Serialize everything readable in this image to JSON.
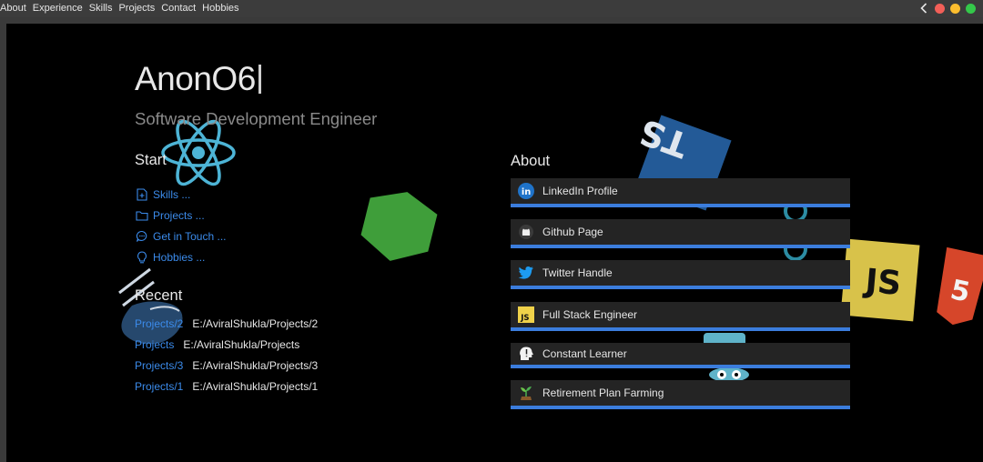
{
  "menu": {
    "items": [
      "About",
      "Experience",
      "Skills",
      "Projects",
      "Contact",
      "Hobbies"
    ]
  },
  "header": {
    "name": "AnonO6",
    "subtitle": "Software Development Engineer"
  },
  "start": {
    "heading": "Start",
    "items": [
      {
        "label": "Skills ...",
        "icon": "file-plus-icon"
      },
      {
        "label": "Projects ...",
        "icon": "folder-icon"
      },
      {
        "label": "Get in Touch ...",
        "icon": "chat-icon"
      },
      {
        "label": "Hobbies ...",
        "icon": "lightbulb-icon"
      }
    ]
  },
  "recent": {
    "heading": "Recent",
    "items": [
      {
        "link": "Projects/2",
        "path": "E:/AviralShukla/Projects/2"
      },
      {
        "link": "Projects",
        "path": "E:/AviralShukla/Projects"
      },
      {
        "link": "Projects/3",
        "path": "E:/AviralShukla/Projects/3"
      },
      {
        "link": "Projects/1",
        "path": "E:/AviralShukla/Projects/1"
      }
    ]
  },
  "about": {
    "heading": "About",
    "cards": [
      {
        "label": "LinkedIn Profile",
        "icon": "linkedin-icon"
      },
      {
        "label": "Github Page",
        "icon": "github-icon"
      },
      {
        "label": "Twitter Handle",
        "icon": "twitter-icon"
      },
      {
        "label": "Full Stack Engineer",
        "icon": "javascript-icon"
      },
      {
        "label": "Constant Learner",
        "icon": "head-idea-icon"
      },
      {
        "label": "Retirement Plan Farming",
        "icon": "sprout-icon"
      }
    ]
  },
  "floating_logos": {
    "typescript": "TS",
    "javascript": "JS",
    "html5": "5"
  },
  "colors": {
    "link_blue": "#3b8beb",
    "card_bg": "#242424",
    "card_border": "#3b7ddd",
    "react_blue": "#5ec8e8",
    "node_green": "#3f9e3a",
    "ts_blue": "#235a97",
    "js_yellow": "#e6d24a",
    "html_orange": "#e44d26"
  }
}
